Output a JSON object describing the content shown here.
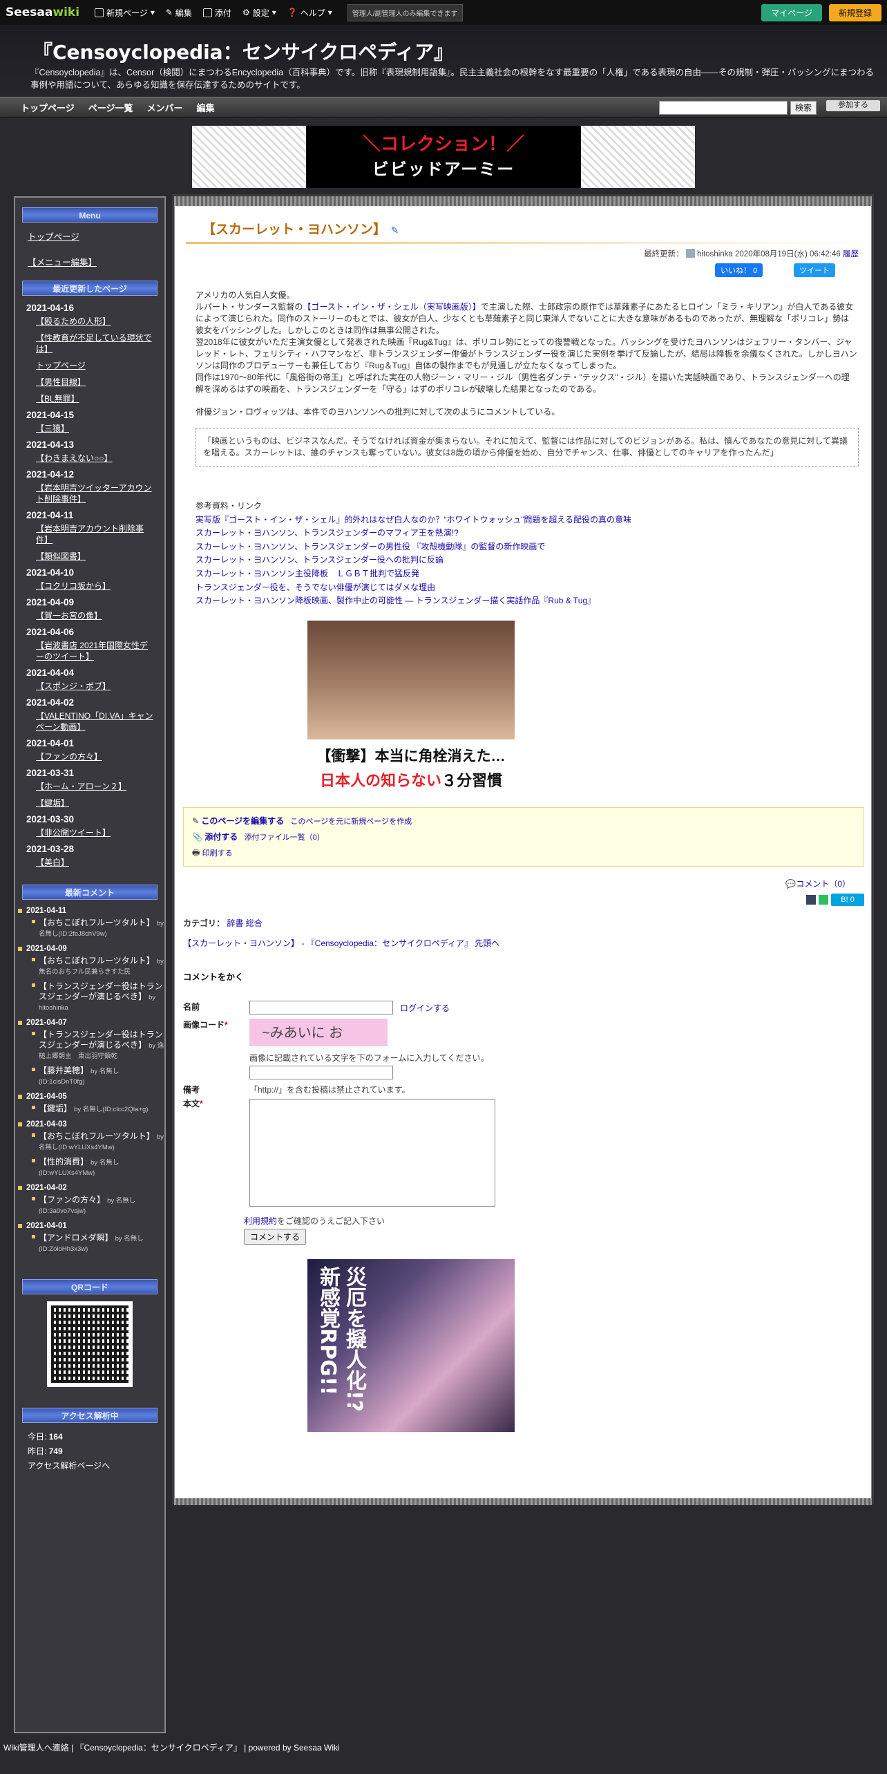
{
  "topbar": {
    "logo_a": "Seesaa",
    "logo_b": "wiki",
    "new_page": "新規ページ",
    "edit": "編集",
    "attach": "添付",
    "settings": "設定",
    "help": "ヘルプ",
    "notice": "管理人/副管理人のみ編集できます",
    "mypage": "マイページ",
    "register": "新規登録"
  },
  "header": {
    "title": "『Censoyclopedia：センサイクロペディア』",
    "desc": "『Censoyclopedia』は、Censor（検閲）にまつわるEncyclopedia（百科事典）です。旧称『表現規制用語集』。民主主義社会の根幹をなす最重要の「人権」である表現の自由――その規制・弾圧・バッシングにまつわる事例や用語について、あらゆる知識を保存伝達するためのサイトです。"
  },
  "gnav": {
    "items": [
      "トップページ",
      "ページ一覧",
      "メンバー",
      "編集"
    ],
    "search_btn": "検索",
    "join": "参加する"
  },
  "banner": {
    "t1": "＼コレクション！／",
    "t2": "ビビッドアーミー"
  },
  "sidebar": {
    "menu_title": "Menu",
    "menu_items": [
      "トップページ",
      "【メニュー編集】"
    ],
    "recent_title": "最近更新したページ",
    "recent": [
      {
        "date": "2021-04-16",
        "pages": [
          "【殴るための人形】",
          "【性教育が不足している現状では】",
          "トップページ",
          "【男性目線】",
          "【BL無罪】"
        ]
      },
      {
        "date": "2021-04-15",
        "pages": [
          "【三猿】"
        ]
      },
      {
        "date": "2021-04-13",
        "pages": [
          "【わきまえない○○】"
        ]
      },
      {
        "date": "2021-04-12",
        "pages": [
          "【岩本明吉ツイッターアカウント削除事件】"
        ]
      },
      {
        "date": "2021-04-11",
        "pages": [
          "【岩本明吉アカウント削除事件】",
          "【類似図書】"
        ]
      },
      {
        "date": "2021-04-10",
        "pages": [
          "【コクリコ坂から】"
        ]
      },
      {
        "date": "2021-04-09",
        "pages": [
          "【賀一お宮の像】"
        ]
      },
      {
        "date": "2021-04-06",
        "pages": [
          "【岩波書店 2021年国際女性デーのツイート】"
        ]
      },
      {
        "date": "2021-04-04",
        "pages": [
          "【スポンジ・ボブ】"
        ]
      },
      {
        "date": "2021-04-02",
        "pages": [
          "【VALENTINO「DI.VA」キャンペーン動画】"
        ]
      },
      {
        "date": "2021-04-01",
        "pages": [
          "【ファンの方々】"
        ]
      },
      {
        "date": "2021-03-31",
        "pages": [
          "【ホーム・アローン２】"
        ]
      },
      {
        "date": "",
        "pages": [
          "【鍵垢】"
        ]
      },
      {
        "date": "2021-03-30",
        "pages": [
          "【非公開ツイート】"
        ]
      },
      {
        "date": "2021-03-28",
        "pages": [
          "【美白】"
        ]
      }
    ],
    "comments_title": "最新コメント",
    "comments": [
      {
        "date": "2021-04-11",
        "items": [
          {
            "page": "【おちこぼれフルーツタルト】",
            "by": "by 名無し(ID:2feJ8chV9w)"
          }
        ]
      },
      {
        "date": "2021-04-09",
        "items": [
          {
            "page": "【おちこぼれフルーツタルト】",
            "by": "by 無名のおちフル民兼らきすた民"
          },
          {
            "page": "【トランスジェンダー役はトランスジェンダーが演じるべき】",
            "by": "by hitoshinka"
          }
        ]
      },
      {
        "date": "2021-04-07",
        "items": [
          {
            "page": "【トランスジェンダー役はトランスジェンダーが演じるべき】",
            "by": "by 逸槌上郷朝主　東出羽守鎮乾"
          },
          {
            "page": "【藤井美穂】",
            "by": "by 名無し(ID:1cisDnT0fg)"
          }
        ]
      },
      {
        "date": "2021-04-05",
        "items": [
          {
            "page": "【鍵垢】",
            "by": "by 名無し(ID:clcc2QIa+g)"
          }
        ]
      },
      {
        "date": "2021-04-03",
        "items": [
          {
            "page": "【おちこぼれフルーツタルト】",
            "by": "by 名無し(ID:wYLUXs4YMw)"
          },
          {
            "page": "【性的消費】",
            "by": "by 名無し(ID:wYLUXs4YMw)"
          }
        ]
      },
      {
        "date": "2021-04-02",
        "items": [
          {
            "page": "【ファンの方々】",
            "by": "by 名無し(ID:3a0vo7vsjw)"
          }
        ]
      },
      {
        "date": "2021-04-01",
        "items": [
          {
            "page": "【アンドロメダ瞬】",
            "by": "by 名無し(ID:ZoloHh3x3w)"
          }
        ]
      }
    ],
    "qr_title": "QRコード",
    "access_title": "アクセス解析中",
    "today_label": "今日:",
    "today": "164",
    "yesterday_label": "昨日:",
    "yesterday": "749",
    "access_link": "アクセス解析ページへ"
  },
  "main": {
    "title": "【スカーレット・ヨハンソン】",
    "updated": "最終更新：",
    "updated_by": "hitoshinka 2020年08月19日(水) 06:42:46",
    "history": "履歴",
    "fb": "いいね！ 0",
    "tw": "ツイート",
    "p1": "アメリカの人気白人女優。",
    "p2_a": "ルパート・サンダース監督の",
    "p2_link": "【ゴースト・イン・ザ・シェル（実写映画版）】",
    "p2_b": "で主演した際、士郎政宗の原作では草薙素子にあたるヒロイン「ミラ・キリアン」が白人である彼女によって演じられた。同作のストーリーのもとでは、彼女が白人、少なくとも草薙素子と同じ東洋人でないことに大きな意味があるものであったが、無理解な「ポリコレ」勢は彼女をバッシングした。しかしこのときは同作は無事公開された。",
    "p3": "翌2018年に彼女がいただ主演女優として発表された映画『Rug&Tug』は、ポリコレ勢にとっての復讐戦となった。バッシングを受けたヨハンソンはジェフリー・タンバー、ジャレッド・レト、フェリシティ・ハフマンなど、非トランスジェンダー俳優がトランスジェンダー役を演じた実例を挙げて反論したが、結局は降板を余儀なくされた。しかしヨハンソンは同作のプロデューサーも兼任しており『Rug＆Tug』自体の製作までもが見通しが立たなくなってしまった。",
    "p4": "同作は1970～80年代に「風俗街の帝王」と呼ばれた実在の人物ジーン・マリー・ジル（男性名ダンテ・\"テックス\"・ジル）を描いた実話映画であり、トランスジェンダーへの理解を深めるはずの映画を、トランスジェンダーを「守る」はずのポリコレが破壊した結果となったのである。",
    "p5": "俳優ジョン・ロヴィッツは、本件でのヨハンソンへの批判に対して次のようにコメントしている。",
    "quote": "「映画というものは、ビジネスなんだ。そうでなければ資金が集まらない。それに加えて、監督には作品に対してのビジョンがある。私は、慎んであなたの意見に対して異議を唱える。スカーレットは、誰のチャンスも奪っていない。彼女は8歳の頃から俳優を始め、自分でチャンス、仕事、俳優としてのキャリアを作ったんだ」",
    "refs_title": "参考資料・リンク",
    "refs": [
      "実写版『ゴースト・イン・ザ・シェル』的外れはなぜ白人なのか？“ホワイトウォッシュ”問題を超える配役の真の意味",
      "スカーレット・ヨハンソン、トランスジェンダーのマフィア王を熱演!?",
      "スカーレット・ヨハンソン、トランスジェンダーの男性役 『攻殻機動隊』の監督の新作映画で",
      "スカーレット・ヨハンソン、トランスジェンダー役への批判に反論",
      "スカーレット・ヨハンソン主役降板　ＬＧＢＴ批判で猛反発",
      "トランスジェンダー役を、そうでない俳優が演じてはダメな理由",
      "スカーレット・ヨハンソン降板映画、製作中止の可能性 ― トランスジェンダー描く実話作品『Rub & Tug』"
    ],
    "ad1_h": "【衝撃】本当に角栓消えた…",
    "ad1_r": "日本人の知らない",
    "ad1_r2": "３分習慣",
    "edit_page": "このページを編集する",
    "new_from": "このページを元に新規ページを作成",
    "attach": "添付する",
    "attach_list": "添付ファイル一覧（0）",
    "print": "印刷する",
    "comment_link": "コメント（0）",
    "share_b": "B! 0",
    "category_label": "カテゴリ：",
    "categories": [
      "辞書",
      "総合"
    ],
    "breadcrumb": "【スカーレット・ヨハンソン】 - 『Censoyclopedia：センサイクロペディア』 先頭へ",
    "form_title": "コメントをかく",
    "name_label": "名前",
    "login": "ログインする",
    "captcha_label": "画像コード",
    "captcha_text": "~みあいに お",
    "captcha_hint": "画像に記載されている文字を下のフォームに入力してください。",
    "note_label": "備考",
    "note": "「http://」を含む投稿は禁止されています。",
    "body_label": "本文",
    "terms": "利用規約",
    "terms_b": "をご確認のうえご記入下さい",
    "submit": "コメントする",
    "ad2_text": "災厄を擬人化!? 新感覚RPG!!"
  },
  "footer": {
    "admin": "Wiki管理人へ連絡",
    "site": "『Censoyclopedia：センサイクロペディア』",
    "powered": "powered by",
    "seesaa": "Seesaa Wiki"
  }
}
